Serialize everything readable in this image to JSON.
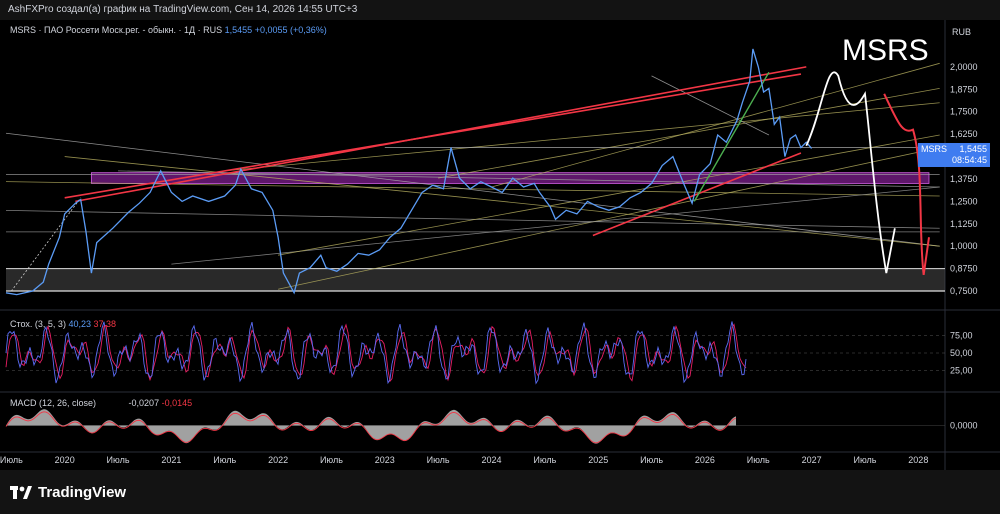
{
  "header": {
    "caption": "AshFXPro создал(а) график на TradingView.com, Сен 14, 2026 14:55 UTC+3"
  },
  "symbol": {
    "description": "MSRS · ПАО Россети Моск.рег. - обыкн. · 1Д · RUS",
    "last": "1,5455",
    "change": "+0,0055 (+0,36%)",
    "big_label": "MSRS",
    "currency": "RUB",
    "price_tag_symbol": "MSRS",
    "price_tag_value": "1,5455",
    "countdown": "08:54:45"
  },
  "stoch": {
    "label": "Стох. (3, 5, 3)",
    "k": "40,23",
    "d": "37,38"
  },
  "macd": {
    "label": "MACD (12, 26, close)",
    "v1": "-0,0207",
    "v2": "-0,0145"
  },
  "colors": {
    "price_line": "#5b9cf6",
    "red": "#f23645",
    "magenta": "#9c27b0",
    "white": "#ffffff",
    "green": "#4caf50"
  },
  "footer": {
    "brand": "TradingView"
  },
  "chart_data": [
    {
      "type": "line",
      "title": "MSRS · ПАО Россети Моск.рег. - обыкн. · 1Д · RUS",
      "y_ticks": [
        "2,0000",
        "1,8750",
        "1,7500",
        "1,6250",
        "1,3750",
        "1,2500",
        "1,1250",
        "1,0000",
        "0,8750",
        "0,7500"
      ],
      "x_ticks": [
        "Июль",
        "2020",
        "Июль",
        "2021",
        "Июль",
        "2022",
        "Июль",
        "2023",
        "Июль",
        "2024",
        "Июль",
        "2025",
        "Июль",
        "2026",
        "Июль",
        "2027",
        "Июль",
        "2028"
      ],
      "ylim": [
        0.7,
        2.15
      ],
      "series": [
        {
          "values": [
            [
              2019.45,
              0.74
            ],
            [
              2019.55,
              0.73
            ],
            [
              2019.7,
              0.75
            ],
            [
              2019.8,
              0.8
            ],
            [
              2019.85,
              0.9
            ],
            [
              2019.95,
              1.05
            ],
            [
              2020.0,
              1.18
            ],
            [
              2020.1,
              1.24
            ],
            [
              2020.15,
              1.26
            ],
            [
              2020.2,
              1.08
            ],
            [
              2020.25,
              0.85
            ],
            [
              2020.3,
              1.02
            ],
            [
              2020.45,
              1.1
            ],
            [
              2020.6,
              1.19
            ],
            [
              2020.7,
              1.24
            ],
            [
              2020.8,
              1.3
            ],
            [
              2020.9,
              1.42
            ],
            [
              2021.0,
              1.3
            ],
            [
              2021.1,
              1.25
            ],
            [
              2021.2,
              1.28
            ],
            [
              2021.35,
              1.25
            ],
            [
              2021.5,
              1.28
            ],
            [
              2021.6,
              1.34
            ],
            [
              2021.65,
              1.43
            ],
            [
              2021.75,
              1.32
            ],
            [
              2021.85,
              1.3
            ],
            [
              2021.95,
              1.2
            ],
            [
              2022.0,
              1.05
            ],
            [
              2022.05,
              0.85
            ],
            [
              2022.15,
              0.74
            ],
            [
              2022.2,
              0.85
            ],
            [
              2022.3,
              0.88
            ],
            [
              2022.4,
              0.95
            ],
            [
              2022.45,
              0.88
            ],
            [
              2022.55,
              0.86
            ],
            [
              2022.65,
              0.9
            ],
            [
              2022.75,
              0.96
            ],
            [
              2022.85,
              0.95
            ],
            [
              2022.95,
              0.98
            ],
            [
              2023.05,
              1.05
            ],
            [
              2023.15,
              1.1
            ],
            [
              2023.25,
              1.2
            ],
            [
              2023.35,
              1.3
            ],
            [
              2023.45,
              1.34
            ],
            [
              2023.55,
              1.32
            ],
            [
              2023.62,
              1.55
            ],
            [
              2023.7,
              1.38
            ],
            [
              2023.8,
              1.32
            ],
            [
              2023.9,
              1.36
            ],
            [
              2024.0,
              1.33
            ],
            [
              2024.1,
              1.3
            ],
            [
              2024.2,
              1.38
            ],
            [
              2024.3,
              1.33
            ],
            [
              2024.4,
              1.35
            ],
            [
              2024.45,
              1.3
            ],
            [
              2024.55,
              1.22
            ],
            [
              2024.6,
              1.15
            ],
            [
              2024.7,
              1.2
            ],
            [
              2024.8,
              1.18
            ],
            [
              2024.9,
              1.25
            ],
            [
              2025.0,
              1.22
            ],
            [
              2025.1,
              1.2
            ],
            [
              2025.2,
              1.22
            ],
            [
              2025.3,
              1.27
            ],
            [
              2025.4,
              1.3
            ],
            [
              2025.5,
              1.35
            ],
            [
              2025.6,
              1.45
            ],
            [
              2025.7,
              1.5
            ],
            [
              2025.8,
              1.35
            ],
            [
              2025.88,
              1.24
            ],
            [
              2025.95,
              1.4
            ],
            [
              2026.05,
              1.46
            ],
            [
              2026.12,
              1.62
            ],
            [
              2026.2,
              1.58
            ],
            [
              2026.3,
              1.7
            ],
            [
              2026.35,
              1.8
            ],
            [
              2026.42,
              1.92
            ],
            [
              2026.45,
              2.1
            ],
            [
              2026.5,
              2.0
            ],
            [
              2026.55,
              1.86
            ],
            [
              2026.6,
              1.88
            ],
            [
              2026.65,
              1.68
            ],
            [
              2026.7,
              1.72
            ],
            [
              2026.75,
              1.5
            ],
            [
              2026.8,
              1.6
            ],
            [
              2026.85,
              1.62
            ],
            [
              2026.9,
              1.55
            ],
            [
              2026.95,
              1.58
            ],
            [
              2027.0,
              1.5455
            ]
          ]
        }
      ]
    },
    {
      "type": "line",
      "title": "Стох. (3, 5, 3)",
      "y_ticks": [
        "75,00",
        "50,00",
        "25,00"
      ],
      "series": [
        {
          "name": "%K",
          "values": [
            40.23
          ]
        },
        {
          "name": "%D",
          "values": [
            37.38
          ]
        }
      ]
    },
    {
      "type": "area",
      "title": "MACD (12, 26, close)",
      "y_ticks": [
        "0,0000"
      ],
      "series": [
        {
          "name": "MACD",
          "values": [
            -0.0207
          ]
        },
        {
          "name": "Signal",
          "values": [
            -0.0145
          ]
        }
      ]
    }
  ]
}
